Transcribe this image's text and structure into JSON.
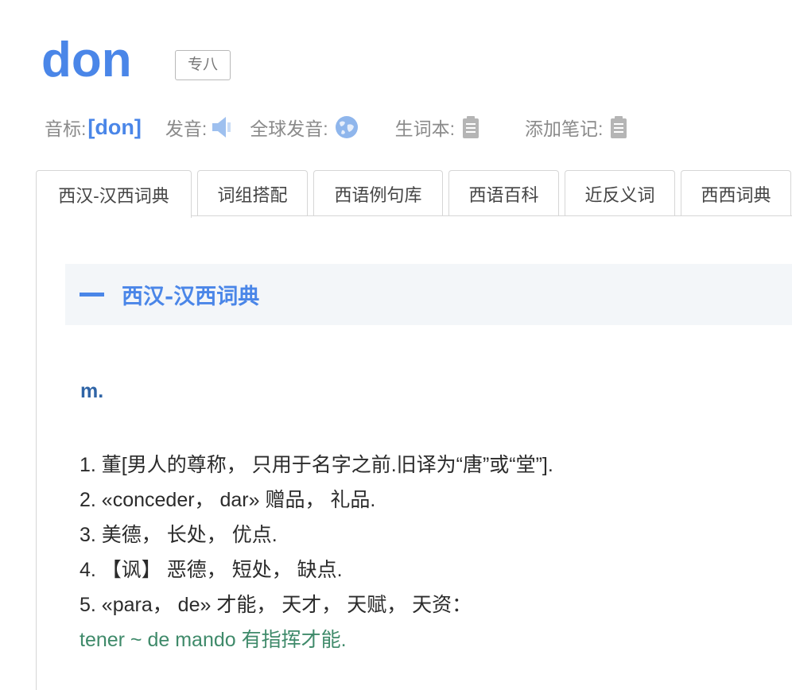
{
  "word": {
    "headword": "don",
    "level_badge": "专八"
  },
  "meta": {
    "phonetic_label": "音标:",
    "phonetic_value": "[don]",
    "pronounce_label": "发音:",
    "global_pronounce_label": "全球发音:",
    "wordbook_label": "生词本:",
    "add_note_label": "添加笔记:"
  },
  "tabs": [
    {
      "label": "西汉-汉西词典",
      "active": true
    },
    {
      "label": "词组搭配",
      "active": false
    },
    {
      "label": "西语例句库",
      "active": false
    },
    {
      "label": "西语百科",
      "active": false
    },
    {
      "label": "近反义词",
      "active": false
    },
    {
      "label": "西西词典",
      "active": false
    }
  ],
  "section": {
    "title": "西汉-汉西词典",
    "part_of_speech": "m.",
    "definitions": [
      "1. 董[男人的尊称， 只用于名字之前.旧译为“唐”或“堂”].",
      "2. «conceder， dar» 赠品， 礼品.",
      "3. 美德， 长处， 优点.",
      "4. 【讽】 恶德， 短处， 缺点.",
      "5. «para， de» 才能， 天才， 天赋， 天资："
    ],
    "example": "tener ~ de mando 有指挥才能."
  },
  "colors": {
    "accent": "#4a86e8",
    "pos": "#2f64a6",
    "example": "#3f8a6a",
    "header_bg": "#f3f6f9"
  },
  "icons": [
    "speaker-icon",
    "globe-icon",
    "wordbook-icon",
    "note-icon",
    "collapse-icon"
  ]
}
